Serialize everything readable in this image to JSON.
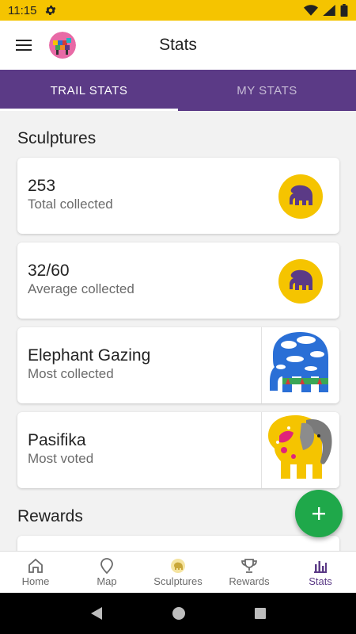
{
  "status_bar": {
    "time": "11:15",
    "settings_icon": "gear-icon",
    "wifi_icon": "wifi-icon",
    "signal_icon": "signal-icon",
    "battery_icon": "battery-icon"
  },
  "app_bar": {
    "title": "Stats",
    "menu_icon": "hamburger-icon",
    "avatar": "avatar"
  },
  "tabs": [
    {
      "label": "TRAIL STATS",
      "active": true
    },
    {
      "label": "MY STATS",
      "active": false
    }
  ],
  "sections": {
    "sculptures_title": "Sculptures",
    "rewards_title": "Rewards"
  },
  "cards": [
    {
      "value": "253",
      "label": "Total collected",
      "icon": "elephant-icon"
    },
    {
      "value": "32/60",
      "label": "Average collected",
      "icon": "elephant-icon"
    },
    {
      "value": "Elephant Gazing",
      "label": "Most collected",
      "image": "elephant-sculpture-sky"
    },
    {
      "value": "Pasifika",
      "label": "Most voted",
      "image": "elephant-sculpture-yellow"
    }
  ],
  "fab": {
    "icon": "plus-icon"
  },
  "bottom_nav": [
    {
      "label": "Home",
      "icon": "home-icon",
      "active": false
    },
    {
      "label": "Map",
      "icon": "map-pin-icon",
      "active": false
    },
    {
      "label": "Sculptures",
      "icon": "sculpture-icon",
      "active": false
    },
    {
      "label": "Rewards",
      "icon": "trophy-icon",
      "active": false
    },
    {
      "label": "Stats",
      "icon": "bar-chart-icon",
      "active": true
    }
  ],
  "colors": {
    "accent": "#5b3a86",
    "status": "#f5c400",
    "fab": "#1fa84a"
  }
}
